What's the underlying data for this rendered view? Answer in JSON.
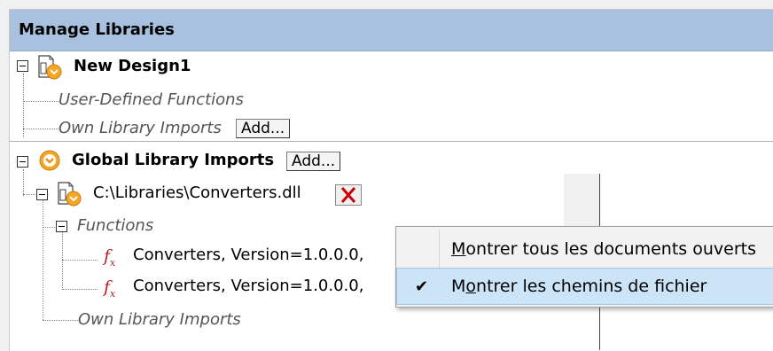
{
  "title": "Manage Libraries",
  "design": {
    "name": "New Design1",
    "user_defined_functions": "User-Defined Functions",
    "own_library_imports": "Own Library Imports",
    "add_label": "Add..."
  },
  "global": {
    "title": "Global Library Imports",
    "add_label": "Add...",
    "library_path": "C:\\Libraries\\Converters.dll",
    "functions_label": "Functions",
    "function_items": [
      "Converters, Version=1.0.0.0,",
      "Converters, Version=1.0.0.0,"
    ],
    "own_library_imports": "Own Library Imports"
  },
  "context_menu": {
    "items": [
      {
        "mnemonic": "M",
        "rest": "ontrer tous les documents ouverts",
        "checked": false
      },
      {
        "pre": "M",
        "mnemonic": "o",
        "rest": "ntrer les chemins de fichier",
        "checked": true
      }
    ]
  },
  "colors": {
    "header_bg": "#a8c1de",
    "delete_red": "#cc0000",
    "fx_red": "#b02020",
    "selected_bg": "#cce4f7"
  }
}
